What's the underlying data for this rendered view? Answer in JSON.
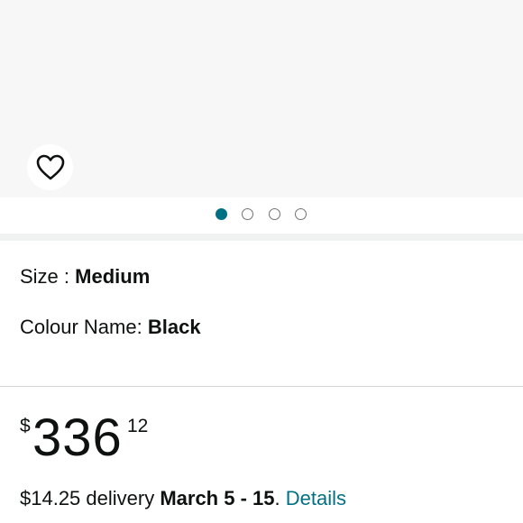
{
  "gallery": {
    "wishlist_icon": "heart-outline-icon",
    "image_count": 4,
    "active_index": 0,
    "colors": {
      "background": "#f7f7f7",
      "dot_active": "#007185",
      "dot_inactive": "#6f7373"
    }
  },
  "variations": {
    "size_label": "Size : ",
    "size_value": "Medium",
    "colour_label": "Colour Name: ",
    "colour_value": "Black"
  },
  "price": {
    "symbol": "$",
    "whole": "336",
    "fraction": "12"
  },
  "delivery": {
    "fee_text": "$14.25 delivery ",
    "dates": "March 5 - 15",
    "separator": ". ",
    "details_link": "Details",
    "link_color": "#007185"
  }
}
